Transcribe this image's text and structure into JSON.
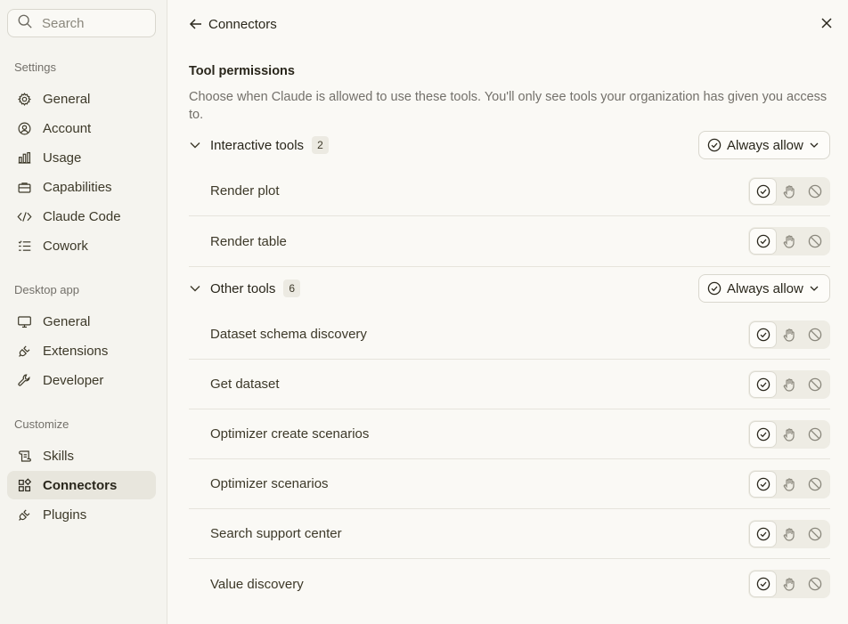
{
  "sidebar": {
    "search": {
      "placeholder": "Search",
      "icon": "search-icon"
    },
    "sections": [
      {
        "label": "Settings",
        "items": [
          {
            "label": "General",
            "icon": "gear-icon"
          },
          {
            "label": "Account",
            "icon": "user-circle-icon"
          },
          {
            "label": "Usage",
            "icon": "bar-chart-icon"
          },
          {
            "label": "Capabilities",
            "icon": "briefcase-icon"
          },
          {
            "label": "Claude Code",
            "icon": "code-icon"
          },
          {
            "label": "Cowork",
            "icon": "checklist-icon"
          }
        ]
      },
      {
        "label": "Desktop app",
        "items": [
          {
            "label": "General",
            "icon": "monitor-icon"
          },
          {
            "label": "Extensions",
            "icon": "plug-icon"
          },
          {
            "label": "Developer",
            "icon": "wrench-icon"
          }
        ]
      },
      {
        "label": "Customize",
        "items": [
          {
            "label": "Skills",
            "icon": "scroll-icon"
          },
          {
            "label": "Connectors",
            "icon": "connectors-icon",
            "active": true
          },
          {
            "label": "Plugins",
            "icon": "plug-icon"
          }
        ]
      }
    ]
  },
  "header": {
    "title": "Connectors"
  },
  "permissions": {
    "title": "Tool permissions",
    "description": "Choose when Claude is allowed to use these tools. You'll only see tools your organization has given you access to.",
    "groups": [
      {
        "name": "Interactive tools",
        "count": "2",
        "policy": "Always allow",
        "tools": [
          "Render plot",
          "Render table"
        ]
      },
      {
        "name": "Other tools",
        "count": "6",
        "policy": "Always allow",
        "tools": [
          "Dataset schema discovery",
          "Get dataset",
          "Optimizer create scenarios",
          "Optimizer scenarios",
          "Search support center",
          "Value discovery"
        ]
      }
    ]
  },
  "colors": {
    "sidebar_bg": "#f5f4ef",
    "main_bg": "#faf9f5",
    "active_item": "#e8e6dd",
    "text": "#29261b",
    "muted": "#73706a"
  }
}
